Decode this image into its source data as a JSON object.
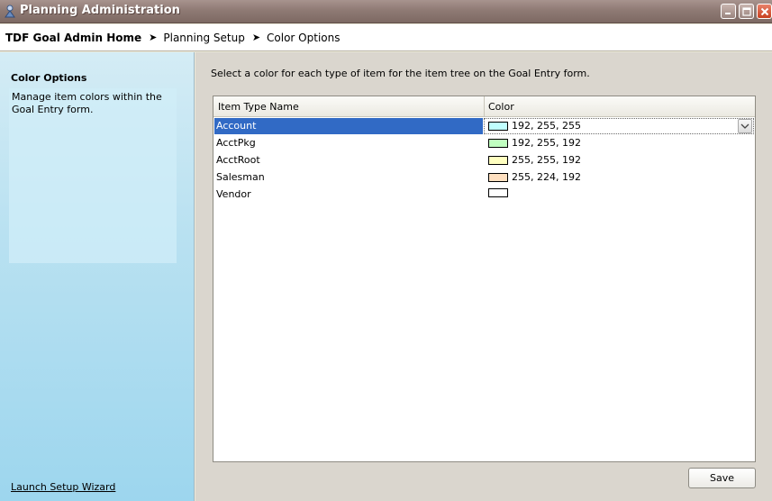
{
  "window": {
    "title": "Planning Administration"
  },
  "breadcrumb": {
    "home": "TDF Goal Admin Home",
    "items": [
      "Planning Setup",
      "Color Options"
    ]
  },
  "left_panel": {
    "title": "Color Options",
    "description": "Manage item colors within the Goal Entry form.",
    "link": "Launch Setup Wizard"
  },
  "main": {
    "instructions": "Select a color for each type of item for the item tree on the Goal Entry form.",
    "columns": [
      "Item Type Name",
      "Color"
    ],
    "rows": [
      {
        "name": "Account",
        "color_text": "192, 255, 255",
        "swatch": "#c0ffff",
        "selected": true
      },
      {
        "name": "AcctPkg",
        "color_text": "192, 255, 192",
        "swatch": "#c0ffc0"
      },
      {
        "name": "AcctRoot",
        "color_text": "255, 255, 192",
        "swatch": "#ffffc0"
      },
      {
        "name": "Salesman",
        "color_text": "255, 224, 192",
        "swatch": "#ffe0c0"
      },
      {
        "name": "Vendor",
        "color_text": "",
        "swatch": "#ffffff"
      }
    ],
    "save_label": "Save"
  },
  "colors": {
    "selection": "#316ac5",
    "titlebar": "#8f7a74",
    "left_panel": "#b9e1f1"
  }
}
